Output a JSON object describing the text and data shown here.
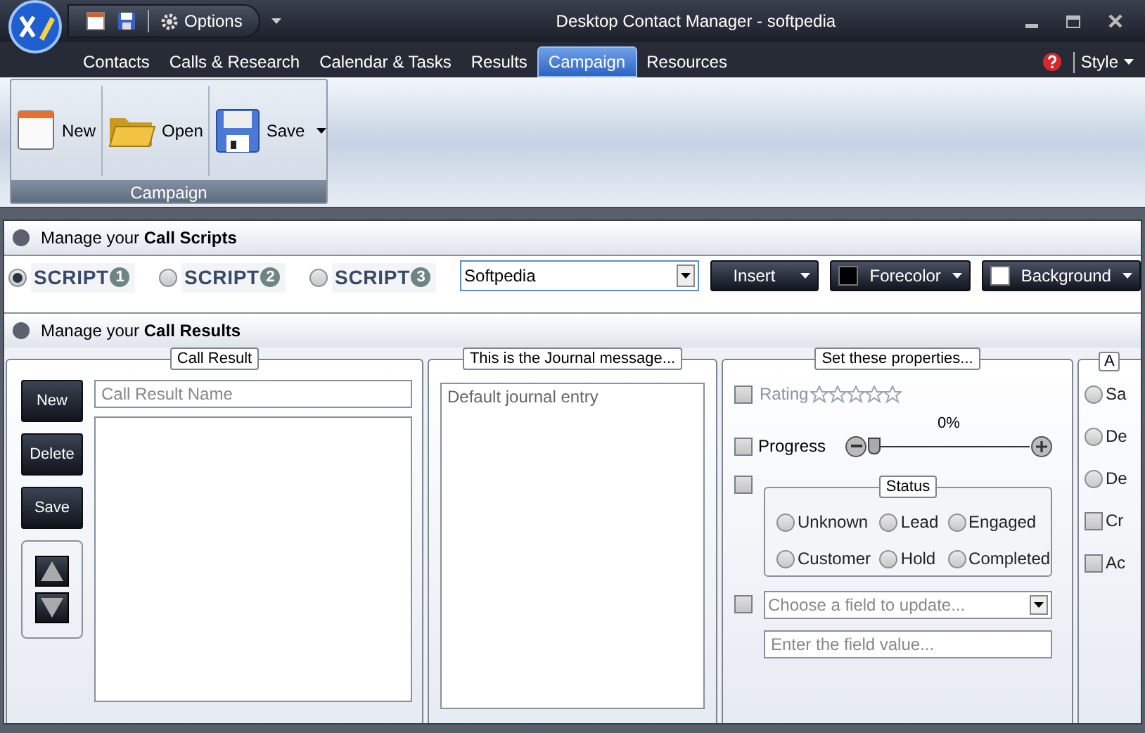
{
  "window": {
    "title": "Desktop Contact Manager - softpedia"
  },
  "quick_access": {
    "options": "Options"
  },
  "menu_tabs": [
    {
      "label": "Contacts",
      "selected": false
    },
    {
      "label": "Calls & Research",
      "selected": false
    },
    {
      "label": "Calendar & Tasks",
      "selected": false
    },
    {
      "label": "Results",
      "selected": false
    },
    {
      "label": "Campaign",
      "selected": true
    },
    {
      "label": "Resources",
      "selected": false
    }
  ],
  "style_menu": "Style",
  "ribbon": {
    "group": "Campaign",
    "buttons": [
      {
        "kind": "new",
        "label": "New"
      },
      {
        "kind": "open",
        "label": "Open"
      },
      {
        "kind": "save",
        "label": "Save"
      }
    ]
  },
  "scripts_section": {
    "title": "Manage your **Call Scripts**",
    "scripts": [
      {
        "label": "SCRIPT",
        "number": "1",
        "selected": true
      },
      {
        "label": "SCRIPT",
        "number": "2",
        "selected": false
      },
      {
        "label": "SCRIPT",
        "number": "3",
        "selected": false
      }
    ],
    "combo_value": "Softpedia",
    "buttons": [
      {
        "kind": "plain",
        "label": "Insert"
      },
      {
        "kind": "fore",
        "label": "Forecolor"
      },
      {
        "kind": "back",
        "label": "Background"
      }
    ]
  },
  "results_section": {
    "title": "Manage your **Call Results**",
    "call_result": {
      "title": "Call Result",
      "buttons": [
        "New",
        "Delete",
        "Save"
      ],
      "name_placeholder": "Call Result Name"
    },
    "journal": {
      "title": "This is the Journal message...",
      "value": "Default journal entry"
    },
    "properties": {
      "title": "Set these properties...",
      "rating": {
        "label": "Rating",
        "checked": false,
        "stars": 0
      },
      "progress": {
        "label": "Progress",
        "checked": false,
        "level": 0,
        "reading": "0%"
      },
      "status": {
        "title": "Status",
        "checked": false,
        "options": [
          {
            "label": "Unknown",
            "selected": false
          },
          {
            "label": "Lead",
            "selected": false
          },
          {
            "label": "Engaged",
            "selected": false
          },
          {
            "label": "Customer",
            "selected": false
          },
          {
            "label": "Hold",
            "selected": false
          },
          {
            "label": "Completed",
            "selected": false
          }
        ]
      },
      "field": {
        "checked": false,
        "placeholder": "Choose a field to update...",
        "value_placeholder": "Enter the field value..."
      }
    },
    "panel_4": {
      "title": "A",
      "items": [
        {
          "kind": "radio",
          "label": "Sa",
          "checked": false
        },
        {
          "kind": "radio",
          "label": "De",
          "checked": false
        },
        {
          "kind": "radio",
          "label": "De",
          "checked": false
        },
        {
          "kind": "checkbox",
          "label": "Cr",
          "checked": false
        },
        {
          "kind": "checkbox",
          "label": "Ac",
          "checked": false
        }
      ]
    }
  }
}
